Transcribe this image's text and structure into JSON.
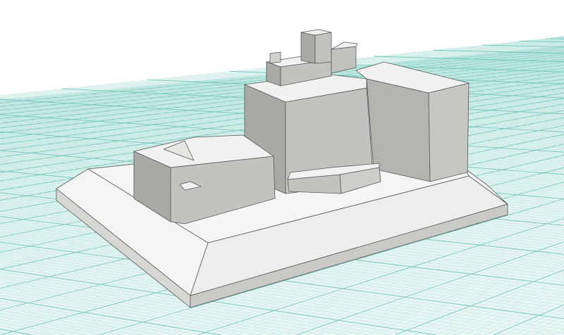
{
  "viewport": {
    "title": "",
    "colors": {
      "background": "#ffffff",
      "floor": "#e9f6f4",
      "grid_minor": "#b5e2dc",
      "grid_major": "#6cc4b9",
      "model_top": "#f1f1ef",
      "model_front": "#c2c2be",
      "model_side": "#a9a9a5",
      "model_edge": "#55575a"
    }
  }
}
